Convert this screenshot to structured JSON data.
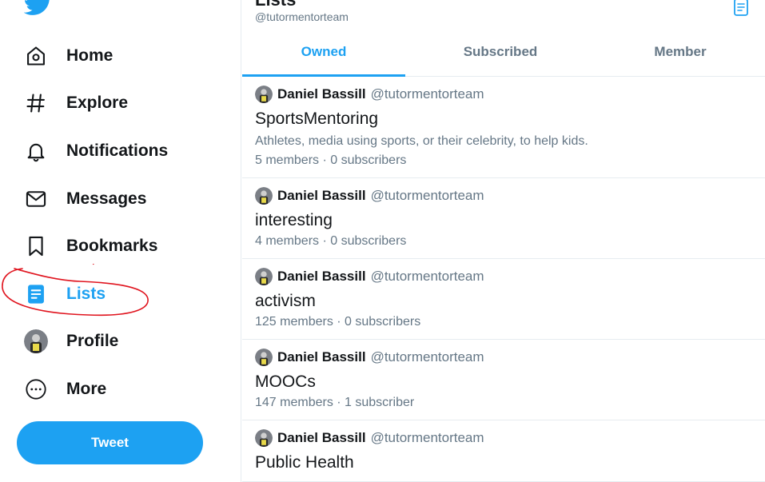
{
  "sidebar": {
    "nav": [
      {
        "label": "Home",
        "icon": "home-icon"
      },
      {
        "label": "Explore",
        "icon": "hashtag-icon"
      },
      {
        "label": "Notifications",
        "icon": "bell-icon"
      },
      {
        "label": "Messages",
        "icon": "envelope-icon"
      },
      {
        "label": "Bookmarks",
        "icon": "bookmark-icon"
      },
      {
        "label": "Lists",
        "icon": "lists-icon",
        "active": true
      },
      {
        "label": "Profile",
        "icon": "avatar"
      },
      {
        "label": "More",
        "icon": "more-icon"
      }
    ],
    "tweet_label": "Tweet"
  },
  "header": {
    "title": "Lists",
    "handle": "@tutormentorteam"
  },
  "tabs": [
    {
      "label": "Owned",
      "active": true
    },
    {
      "label": "Subscribed"
    },
    {
      "label": "Member"
    }
  ],
  "lists": [
    {
      "owner": "Daniel Bassill",
      "handle": "@tutormentorteam",
      "name": "SportsMentoring",
      "description": "Athletes, media using sports, or their celebrity, to help kids.",
      "stats": "5 members · 0 subscribers"
    },
    {
      "owner": "Daniel Bassill",
      "handle": "@tutormentorteam",
      "name": "interesting",
      "description": "",
      "stats": "4 members · 0 subscribers"
    },
    {
      "owner": "Daniel Bassill",
      "handle": "@tutormentorteam",
      "name": "activism",
      "description": "",
      "stats": "125 members · 0 subscribers"
    },
    {
      "owner": "Daniel Bassill",
      "handle": "@tutormentorteam",
      "name": "MOOCs",
      "description": "",
      "stats": "147 members · 1 subscriber"
    },
    {
      "owner": "Daniel Bassill",
      "handle": "@tutormentorteam",
      "name": "Public Health",
      "description": "",
      "stats": ""
    }
  ],
  "colors": {
    "accent": "#1da1f2",
    "text": "#14171a",
    "secondary": "#657786",
    "annotation": "#e0141e"
  }
}
